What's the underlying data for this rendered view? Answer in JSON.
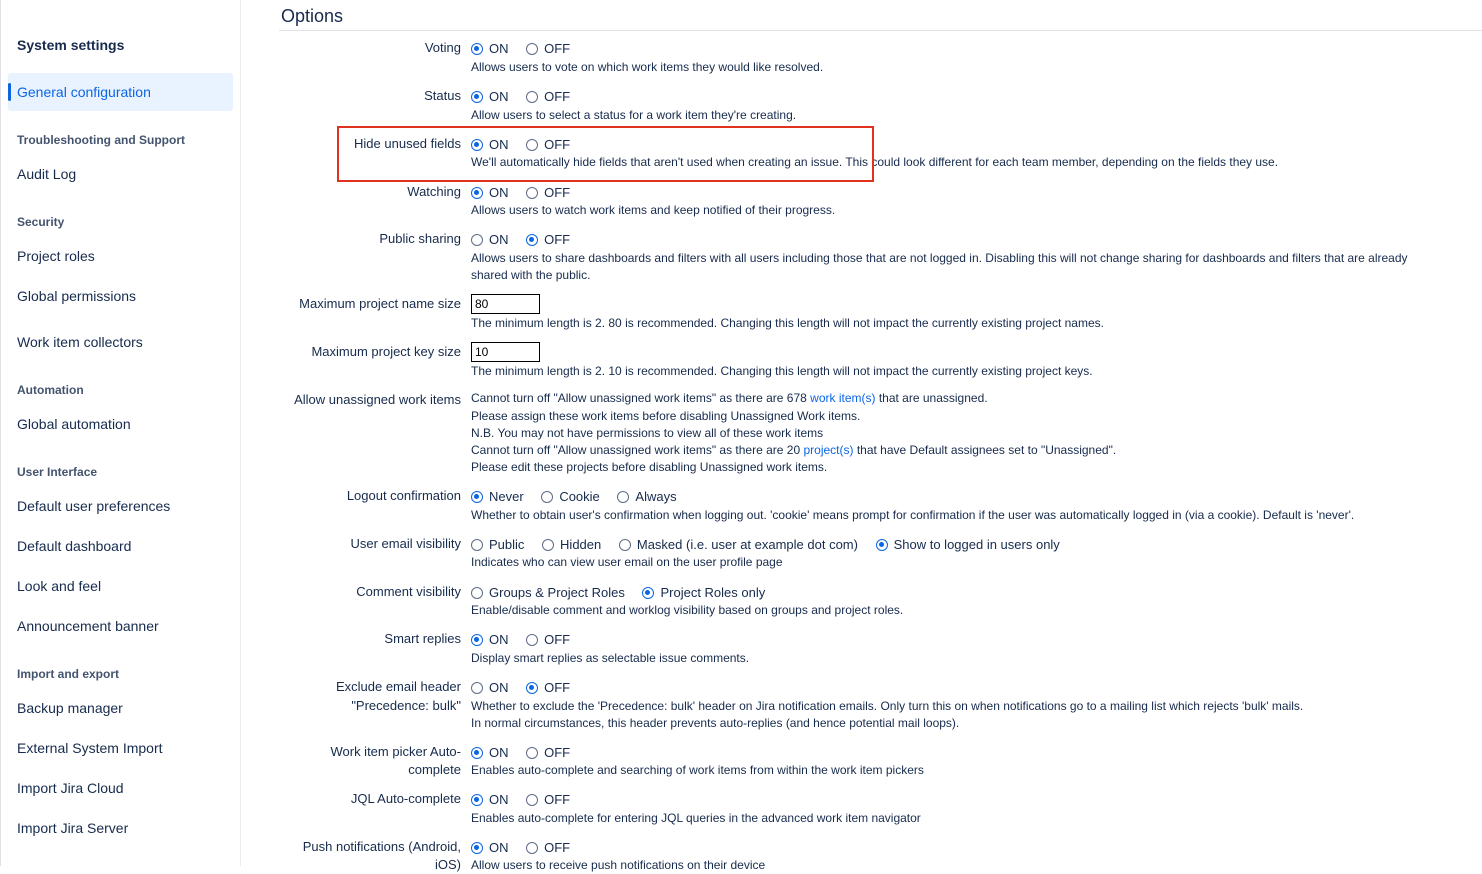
{
  "sidebar": {
    "title": "System settings",
    "active": "General configuration",
    "sections": [
      {
        "heading": "Troubleshooting and Support",
        "items": [
          "Audit Log"
        ]
      },
      {
        "heading": "Security",
        "items": [
          "Project roles",
          "Global permissions",
          "Work item collectors"
        ]
      },
      {
        "heading": "Automation",
        "items": [
          "Global automation"
        ]
      },
      {
        "heading": "User Interface",
        "items": [
          "Default user preferences",
          "Default dashboard",
          "Look and feel",
          "Announcement banner"
        ]
      },
      {
        "heading": "Import and export",
        "items": [
          "Backup manager",
          "External System Import",
          "Import Jira Cloud",
          "Import Jira Server"
        ]
      }
    ]
  },
  "options": {
    "title": "Options",
    "voting": {
      "label": "Voting",
      "on": "ON",
      "off": "OFF",
      "desc": "Allows users to vote on which work items they would like resolved."
    },
    "status": {
      "label": "Status",
      "on": "ON",
      "off": "OFF",
      "desc": "Allow users to select a status for a work item they're creating."
    },
    "hide_unused": {
      "label": "Hide unused fields",
      "on": "ON",
      "off": "OFF",
      "desc": "We'll automatically hide fields that aren't used when creating an issue. This could look different for each team member, depending on the fields they use."
    },
    "watching": {
      "label": "Watching",
      "on": "ON",
      "off": "OFF",
      "desc": "Allows users to watch work items and keep notified of their progress."
    },
    "public_sharing": {
      "label": "Public sharing",
      "on": "ON",
      "off": "OFF",
      "desc1": "Allows users to share dashboards and filters with all users including those that are not logged in. Disabling this will not change sharing for dashboards and filters that are already",
      "desc2": "shared with the public."
    },
    "max_project_name": {
      "label": "Maximum project name size",
      "value": "80",
      "desc": "The minimum length is 2. 80 is recommended. Changing this length will not impact the currently existing project names."
    },
    "max_project_key": {
      "label": "Maximum project key size",
      "value": "10",
      "desc": "The minimum length is 2. 10 is recommended. Changing this length will not impact the currently existing project keys."
    },
    "unassigned": {
      "label": "Allow unassigned work items",
      "l1a": "Cannot turn off \"Allow unassigned work items\" as there are 678 ",
      "l1link": "work item(s)",
      "l1b": " that are unassigned.",
      "l2": "Please assign these work items before disabling Unassigned Work items.",
      "l3": "N.B. You may not have permissions to view all of these work items",
      "l4a": "Cannot turn off \"Allow unassigned work items\" as there are 20 ",
      "l4link": "project(s)",
      "l4b": " that have Default assignees set to \"Unassigned\".",
      "l5": "Please edit these projects before disabling Unassigned work items."
    },
    "logout": {
      "label": "Logout confirmation",
      "o1": "Never",
      "o2": "Cookie",
      "o3": "Always",
      "desc": "Whether to obtain user's confirmation when logging out. 'cookie' means prompt for confirmation if the user was automatically logged in (via a cookie). Default is 'never'."
    },
    "email_vis": {
      "label": "User email visibility",
      "o1": "Public",
      "o2": "Hidden",
      "o3": "Masked (i.e. user at example dot com)",
      "o4": "Show to logged in users only",
      "desc": "Indicates who can view user email on the user profile page"
    },
    "comment_vis": {
      "label": "Comment visibility",
      "o1": "Groups & Project Roles",
      "o2": "Project Roles only",
      "desc": "Enable/disable comment and worklog visibility based on groups and project roles."
    },
    "smart_replies": {
      "label": "Smart replies",
      "on": "ON",
      "off": "OFF",
      "desc": "Display smart replies as selectable issue comments."
    },
    "exclude_header": {
      "label1": "Exclude email header",
      "label2": "\"Precedence: bulk\"",
      "on": "ON",
      "off": "OFF",
      "desc1": "Whether to exclude the 'Precedence: bulk' header on Jira notification emails. Only turn this on when notifications go to a mailing list which rejects 'bulk' mails.",
      "desc2": "In normal circumstances, this header prevents auto-replies (and hence potential mail loops)."
    },
    "picker": {
      "label1": "Work item picker Auto-",
      "label2": "complete",
      "on": "ON",
      "off": "OFF",
      "desc": "Enables auto-complete and searching of work items from within the work item pickers"
    },
    "jql": {
      "label": "JQL Auto-complete",
      "on": "ON",
      "off": "OFF",
      "desc": "Enables auto-complete for entering JQL queries in the advanced work item navigator"
    },
    "push": {
      "label1": "Push notifications (Android,",
      "label2": "iOS)",
      "on": "ON",
      "off": "OFF",
      "desc": "Allow users to receive push notifications on their device"
    }
  }
}
